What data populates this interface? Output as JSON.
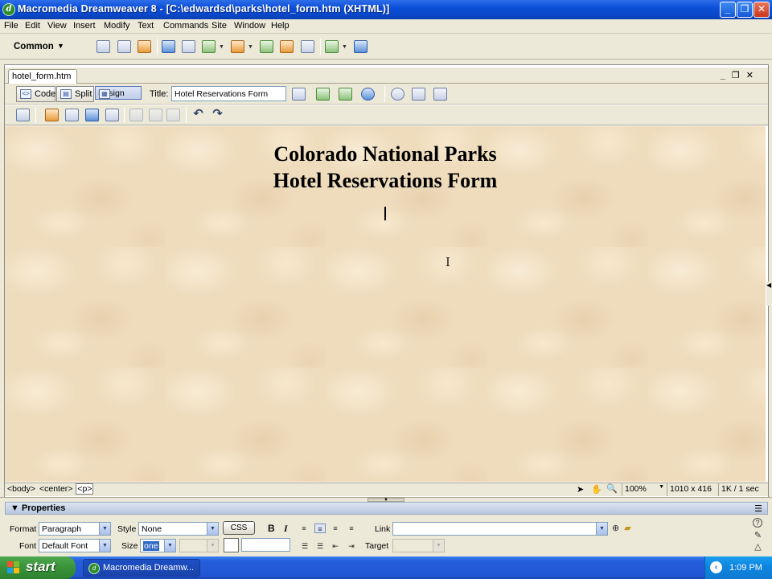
{
  "window": {
    "title": "Macromedia Dreamweaver 8 - [C:\\edwardsd\\parks\\hotel_form.htm (XHTML)]",
    "app_icon": "dreamweaver-icon",
    "controls": [
      "minimize",
      "restore",
      "close"
    ]
  },
  "menubar": {
    "items": [
      "File",
      "Edit",
      "View",
      "Insert",
      "Modify",
      "Text",
      "Commands",
      "Site",
      "Window",
      "Help"
    ]
  },
  "insert_bar": {
    "category": "Common",
    "icons": [
      "hyperlink-icon",
      "email-link-icon",
      "named-anchor-icon",
      "table-icon",
      "div-icon",
      "images-icon",
      "media-icon",
      "date-icon",
      "server-side-include-icon",
      "comment-icon",
      "templates-icon",
      "tag-chooser-icon"
    ]
  },
  "document": {
    "tab_label": "hotel_form.htm",
    "views": {
      "code": "Code",
      "split": "Split",
      "design": "Design"
    },
    "title_label": "Title:",
    "title_value": "Hotel Reservations Form",
    "heading_line1": "Colorado National Parks",
    "heading_line2": "Hotel Reservations Form",
    "background": "parchment-texture"
  },
  "status_bar": {
    "tags": [
      "<body>",
      "<center>",
      "<p>"
    ],
    "zoom": "100%",
    "window_size": "1010 x 416",
    "download": "1K / 1 sec"
  },
  "properties": {
    "title": "Properties",
    "format_label": "Format",
    "format_value": "Paragraph",
    "style_label": "Style",
    "style_value": "None",
    "css_button": "CSS",
    "bold": "B",
    "italic": "I",
    "link_label": "Link",
    "link_value": "",
    "font_label": "Font",
    "font_value": "Default Font",
    "size_label": "Size",
    "size_value": "one",
    "target_label": "Target",
    "target_value": ""
  },
  "taskbar": {
    "start_label": "start",
    "task_item": "Macromedia Dreamw...",
    "clock": "1:09 PM"
  },
  "colors": {
    "titlebar": "#0b4fd8",
    "canvas": "#efdcbd",
    "start_green": "#3c963c",
    "chrome": "#ece9d8"
  }
}
